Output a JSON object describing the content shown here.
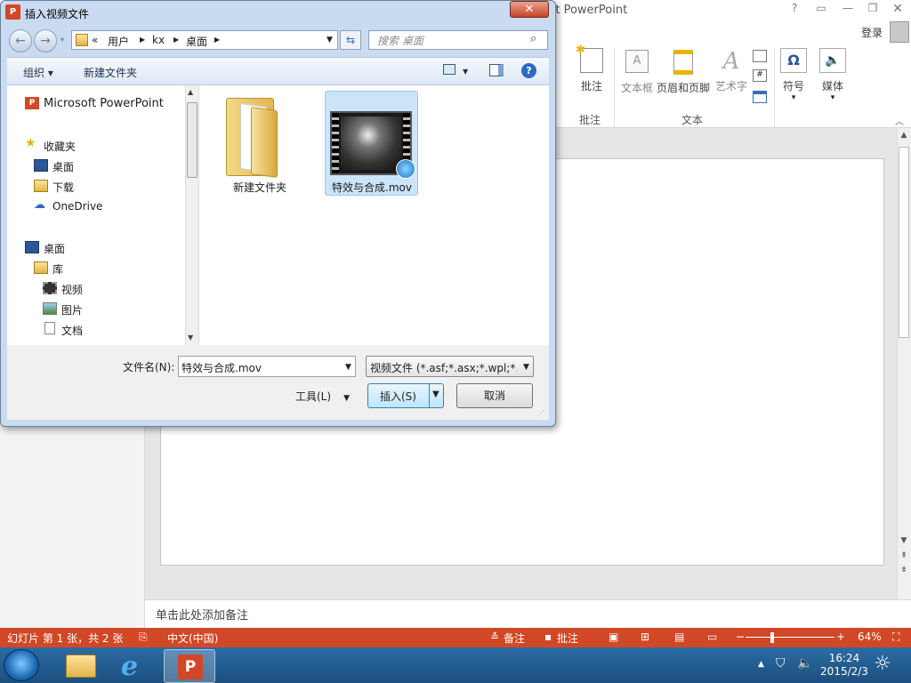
{
  "powerpoint": {
    "title_fragment": "ft PowerPoint",
    "login": "登录",
    "ribbon": {
      "comment": "批注",
      "textbox": "文本框",
      "header_footer": "页眉和页脚",
      "wordart": "艺术字",
      "symbol": "符号",
      "media": "媒体",
      "group_comment": "批注",
      "group_text": "文本"
    },
    "notes_placeholder": "单击此处添加备注",
    "status": {
      "slide_info": "幻灯片 第 1 张，共 2 张",
      "language": "中文(中国)",
      "notes": "备注",
      "comments": "批注",
      "zoom": "64%"
    }
  },
  "taskbar": {
    "time": "16:24",
    "date": "2015/2/3"
  },
  "dialog": {
    "title": "插入视频文件",
    "close": "✕",
    "breadcrumb": [
      "«",
      "用户",
      "kx",
      "桌面"
    ],
    "search_placeholder": "搜索 桌面",
    "toolbar": {
      "organize": "组织 ▾",
      "new_folder": "新建文件夹"
    },
    "nav": {
      "powerpoint": "Microsoft PowerPoint",
      "favorites": "收藏夹",
      "desktop_fav": "桌面",
      "downloads": "下载",
      "onedrive": "OneDrive",
      "desktop": "桌面",
      "library": "库",
      "videos": "视频",
      "pictures": "图片",
      "documents": "文档"
    },
    "files": [
      {
        "name": "新建文件夹"
      },
      {
        "name": "特效与合成.mov"
      }
    ],
    "filename_label": "文件名(N):",
    "filename_value": "特效与合成.mov",
    "filetype_value": "视频文件 (*.asf;*.asx;*.wpl;*.wi",
    "tools": "工具(L)",
    "insert": "插入(S)",
    "cancel": "取消"
  }
}
